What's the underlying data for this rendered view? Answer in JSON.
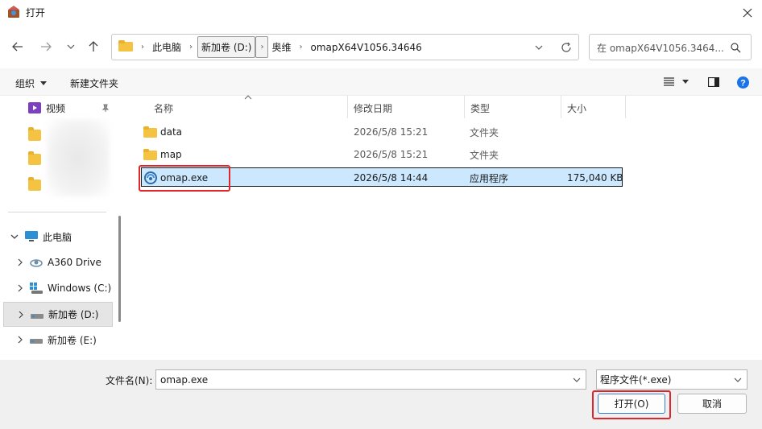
{
  "window": {
    "title": "打开"
  },
  "address": {
    "crumbs": [
      "此电脑",
      "新加卷 (D:)",
      "奥维",
      "omapX64V1056.34646"
    ]
  },
  "search": {
    "placeholder": "在 omapX64V1056.3464..."
  },
  "toolbar": {
    "organize_label": "组织",
    "new_folder_label": "新建文件夹"
  },
  "nav": {
    "quick": [
      {
        "label": "视频"
      }
    ],
    "this_pc": "此电脑",
    "drives": [
      {
        "label": "A360 Drive"
      },
      {
        "label": "Windows (C:)"
      },
      {
        "label": "新加卷 (D:)"
      },
      {
        "label": "新加卷 (E:)"
      }
    ]
  },
  "columns": {
    "name": "名称",
    "date": "修改日期",
    "type": "类型",
    "size": "大小"
  },
  "files": [
    {
      "name": "data",
      "date": "2026/5/8 15:21",
      "type": "文件夹",
      "size": ""
    },
    {
      "name": "map",
      "date": "2026/5/8 15:21",
      "type": "文件夹",
      "size": ""
    },
    {
      "name": "omap.exe",
      "date": "2026/5/8 14:44",
      "type": "应用程序",
      "size": "175,040 KB"
    }
  ],
  "bottom": {
    "filename_label": "文件名(N):",
    "filename_value": "omap.exe",
    "filetype_value": "程序文件(*.exe)",
    "open_label": "打开(O)",
    "cancel_label": "取消"
  },
  "colors": {
    "accent": "#1a73e8",
    "selection": "#cce8ff",
    "highlight_box": "#e0262a",
    "folder": "#f5c342"
  }
}
